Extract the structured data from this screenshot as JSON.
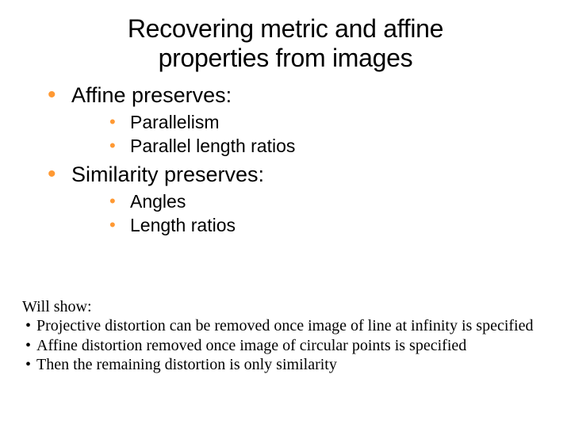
{
  "title_line1": "Recovering metric and affine",
  "title_line2": "properties from images",
  "bullets": [
    {
      "label": "Affine preserves:",
      "subitems": [
        "Parallelism",
        "Parallel length ratios"
      ]
    },
    {
      "label": "Similarity preserves:",
      "subitems": [
        "Angles",
        "Length ratios"
      ]
    }
  ],
  "notes": {
    "heading": "Will show:",
    "items": [
      "Projective distortion can be removed once image of line at infinity is specified",
      "Affine distortion removed once image of circular points is specified",
      "Then the remaining distortion is only similarity"
    ]
  }
}
